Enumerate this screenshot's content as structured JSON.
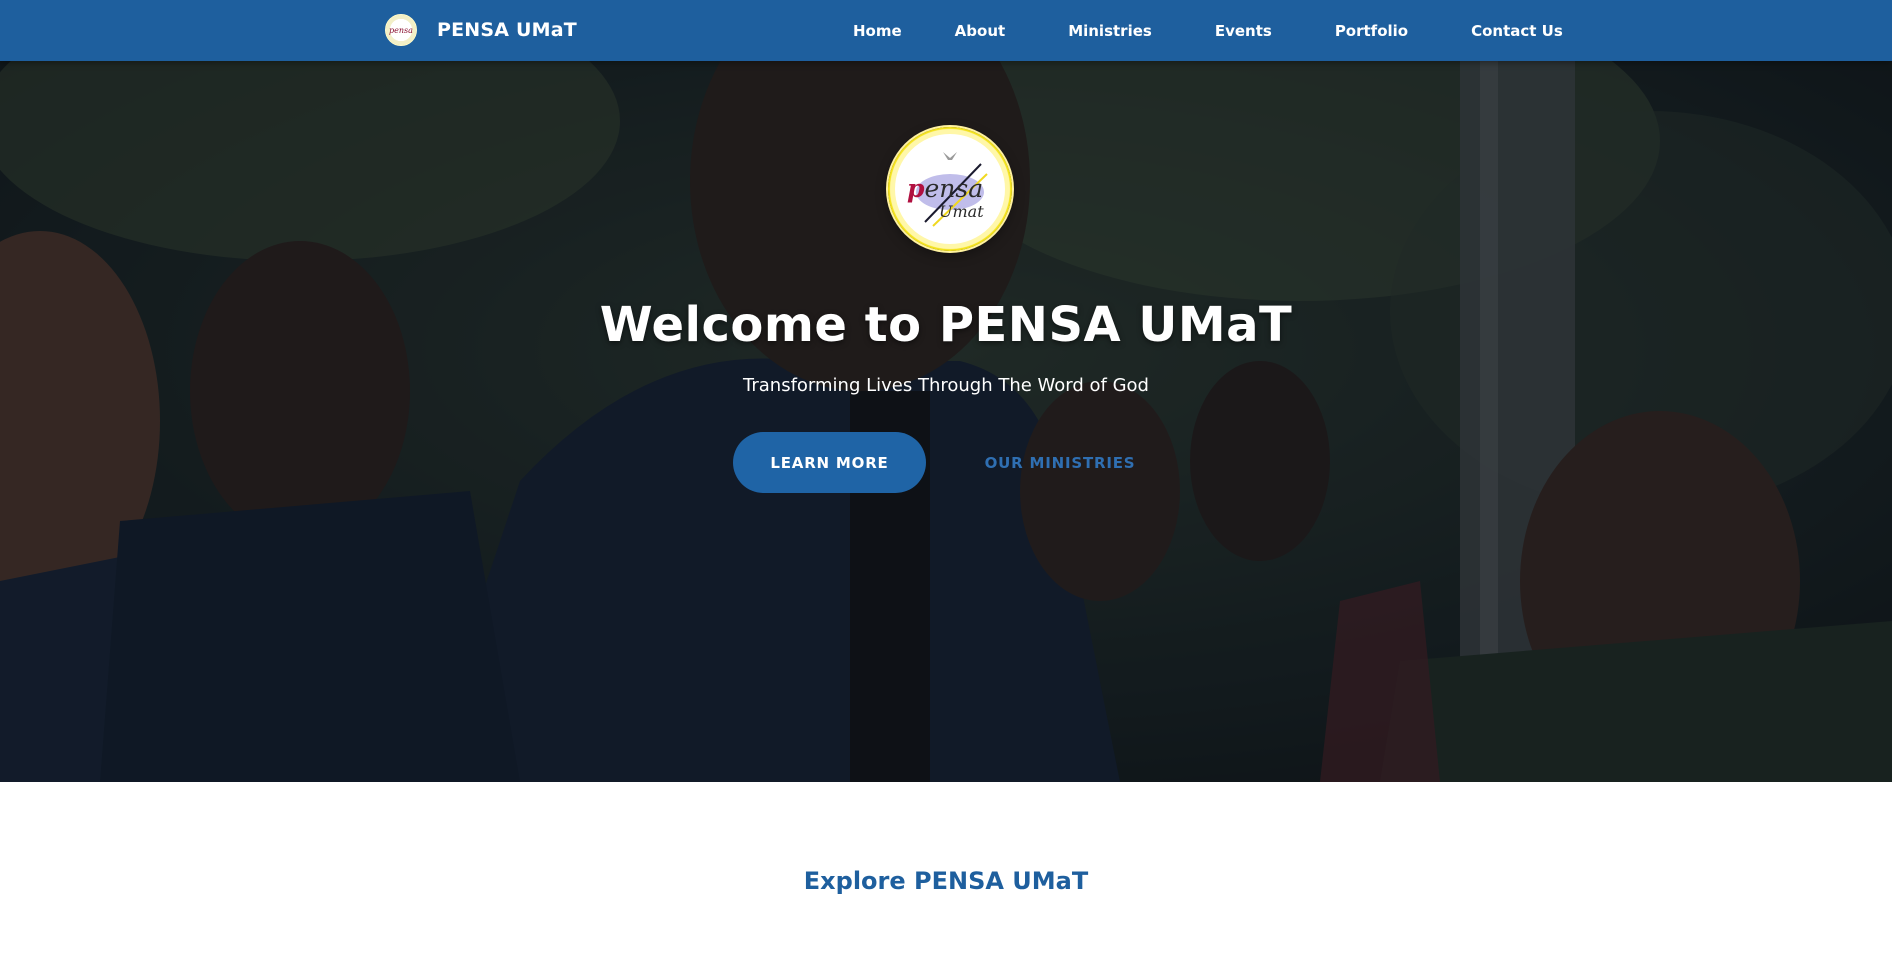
{
  "navbar": {
    "brand_name": "PENSA UMaT",
    "logo_text": "pensa",
    "links": [
      {
        "label": "Home"
      },
      {
        "label": "About"
      },
      {
        "label": "Ministries"
      },
      {
        "label": "Events"
      },
      {
        "label": "Portfolio"
      },
      {
        "label": "Contact Us"
      }
    ]
  },
  "hero": {
    "logo_text_main": "ensa",
    "logo_text_p": "p",
    "logo_text_sub": "Umat",
    "title": "Welcome to PENSA UMaT",
    "subtitle": "Transforming Lives Through The Word of God",
    "primary_button": "LEARN MORE",
    "secondary_button": "OUR MINISTRIES"
  },
  "explore": {
    "title": "Explore PENSA UMaT"
  },
  "colors": {
    "primary": "#1e5f9e",
    "accent_link": "#2f6fb2",
    "hero_overlay": "#0a0e14",
    "logo_ring": "#f3e21c"
  }
}
